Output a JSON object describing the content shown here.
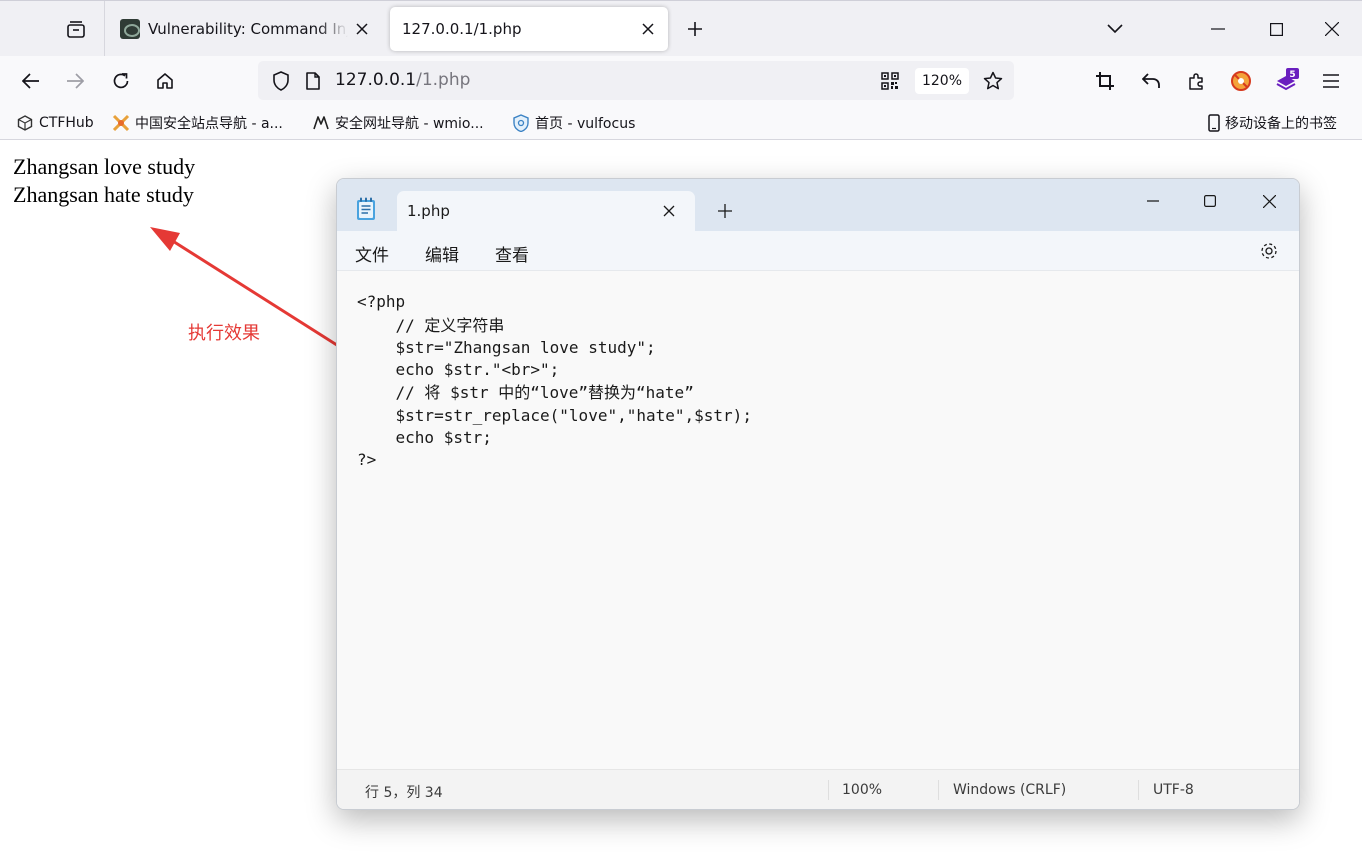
{
  "browser": {
    "tabs": [
      {
        "title": "Vulnerability: Command Injection",
        "active": false
      },
      {
        "title": "127.0.0.1/1.php",
        "active": true
      }
    ],
    "url": {
      "host": "127.0.0.1",
      "path": "/1.php"
    },
    "zoom": "120%",
    "bookmarks": [
      {
        "label": "CTFHub",
        "icon": "cube-icon"
      },
      {
        "label": "中国安全站点导航 - a...",
        "icon": "crossed-swords-icon"
      },
      {
        "label": "安全网址导航 - wmio...",
        "icon": "logo-icon"
      },
      {
        "label": "首页 - vulfocus",
        "icon": "shield-logo-icon"
      }
    ],
    "mobile_bookmarks": "移动设备上的书签",
    "extension_badge": "5"
  },
  "page": {
    "lines": [
      "Zhangsan love study",
      "Zhangsan hate study"
    ],
    "annotation": "执行效果",
    "annotation_color": "#e53935"
  },
  "notepad": {
    "tab_title": "1.php",
    "menu": [
      "文件",
      "编辑",
      "查看"
    ],
    "code": [
      "<?php",
      "    // 定义字符串",
      "    $str=\"Zhangsan love study\";",
      "    echo $str.\"<br>\";",
      "    // 将 $str 中的“love”替换为“hate”",
      "    $str=str_replace(\"love\",\"hate\",$str);",
      "    echo $str;",
      "?>"
    ],
    "status": {
      "position": "行 5，列 34",
      "zoom": "100%",
      "line_ending": "Windows (CRLF)",
      "encoding": "UTF-8"
    }
  }
}
